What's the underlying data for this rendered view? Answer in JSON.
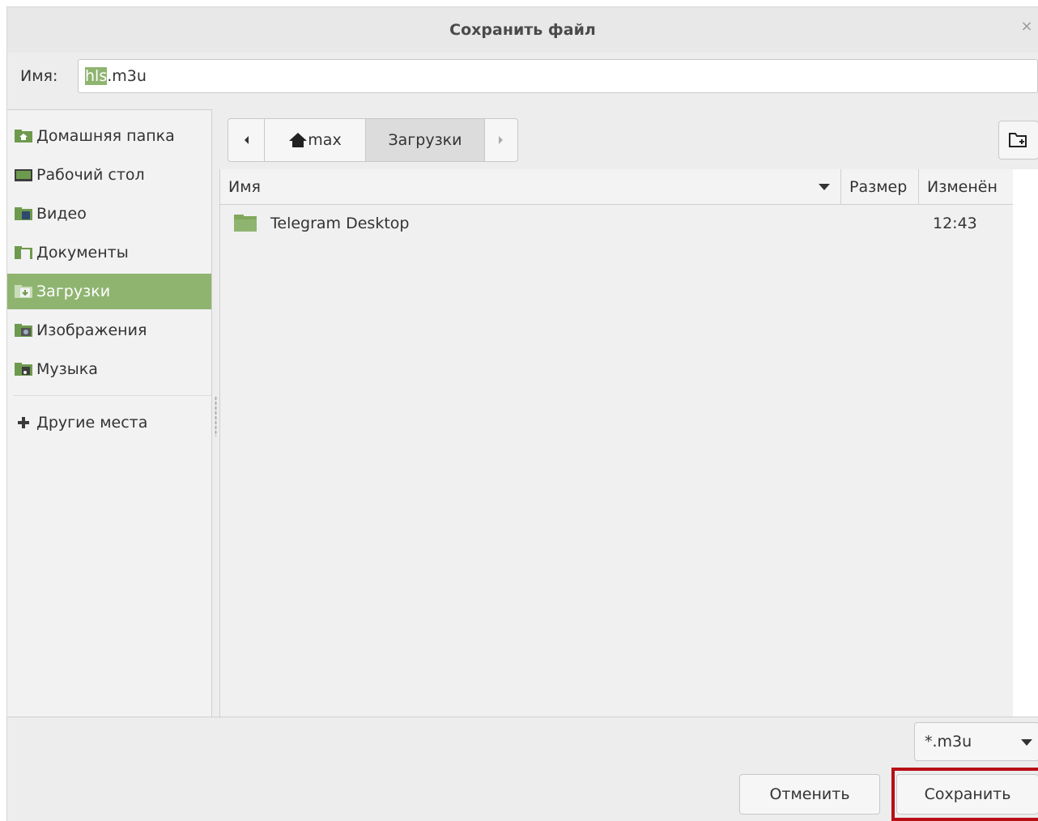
{
  "dialog": {
    "title": "Сохранить файл",
    "close_icon": "×"
  },
  "name_field": {
    "label": "Имя:",
    "value_selected": "hls",
    "value_rest": ".m3u"
  },
  "sidebar": {
    "items": [
      {
        "label": "Домашняя папка",
        "icon": "home-folder-icon"
      },
      {
        "label": "Рабочий стол",
        "icon": "desktop-folder-icon"
      },
      {
        "label": "Видео",
        "icon": "video-folder-icon"
      },
      {
        "label": "Документы",
        "icon": "documents-folder-icon"
      },
      {
        "label": "Загрузки",
        "icon": "downloads-folder-icon",
        "active": true
      },
      {
        "label": "Изображения",
        "icon": "pictures-folder-icon"
      },
      {
        "label": "Музыка",
        "icon": "music-folder-icon"
      }
    ],
    "other_places": "Другие места"
  },
  "pathbar": {
    "segments": [
      "max",
      "Загрузки"
    ],
    "current": "Загрузки"
  },
  "filelist": {
    "columns": {
      "name": "Имя",
      "size": "Размер",
      "modified": "Изменён"
    },
    "rows": [
      {
        "name": "Telegram Desktop",
        "size": "",
        "modified": "12:43"
      }
    ]
  },
  "filter": {
    "value": "*.m3u"
  },
  "buttons": {
    "cancel": "Отменить",
    "save": "Сохранить"
  },
  "colors": {
    "accent": "#8fb470",
    "highlight": "#b80f16",
    "background": "#ededed"
  }
}
